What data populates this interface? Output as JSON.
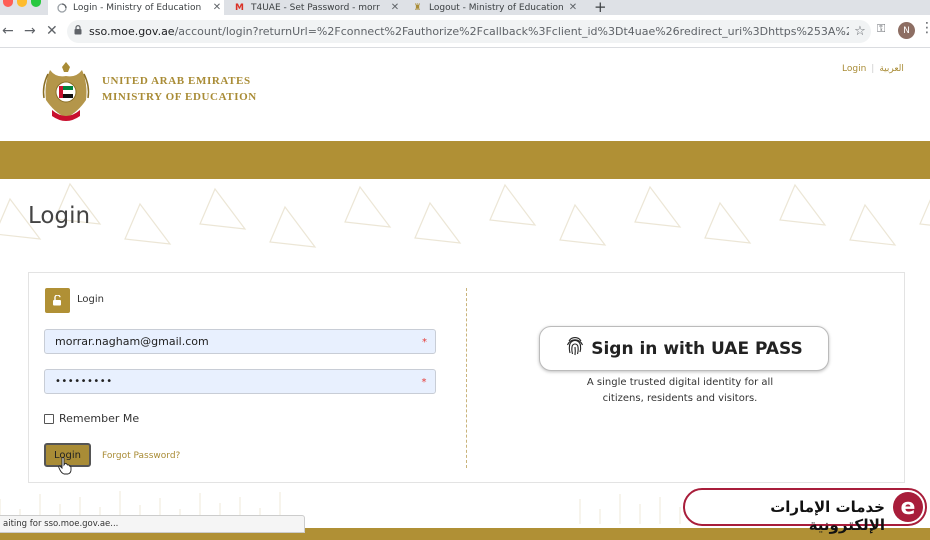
{
  "browser": {
    "tabs": [
      {
        "title": "Login - Ministry of Education",
        "active": true,
        "favicon": "loading-spinner-icon"
      },
      {
        "title": "T4UAE - Set Password - morr",
        "active": false,
        "favicon": "gmail-icon"
      },
      {
        "title": "Logout - Ministry of Education",
        "active": false,
        "favicon": "emblem-icon"
      }
    ],
    "new_tab": "+",
    "url_host": "sso.moe.gov.ae",
    "url_path": "/account/login?returnUrl=%2Fconnect%2Fauthorize%2Fcallback%3Fclient_id%3Dt4uae%26redirect_uri%3Dhttps%253A%252F%252...",
    "profile_initial": "N"
  },
  "header": {
    "org_line1": "UNITED ARAB EMIRATES",
    "org_line2": "MINISTRY OF EDUCATION",
    "lang_login": "Login",
    "lang_arabic": "العربية"
  },
  "page": {
    "title": "Login"
  },
  "login_form": {
    "heading": "Login",
    "email_value": "morrar.nagham@gmail.com",
    "password_value": "•••••••••",
    "required_mark": "*",
    "remember_label": "Remember Me",
    "remember_checked": false,
    "login_button": "Login",
    "forgot_link": "Forgot Password?"
  },
  "uae_pass": {
    "button_label": "Sign in with UAE PASS",
    "desc_line1": "A single trusted digital identity for all",
    "desc_line2": "citizens, residents and visitors."
  },
  "status_bar": {
    "text": "aiting for sso.moe.gov.ae..."
  },
  "watermark": {
    "text": "خدمات الإمارات الإلكترونية",
    "logo_letter": "e"
  },
  "colors": {
    "gold": "#b09035",
    "gold_text": "#a98c36",
    "watermark_red": "#a81d3a",
    "input_bg": "#e8f0fe"
  }
}
